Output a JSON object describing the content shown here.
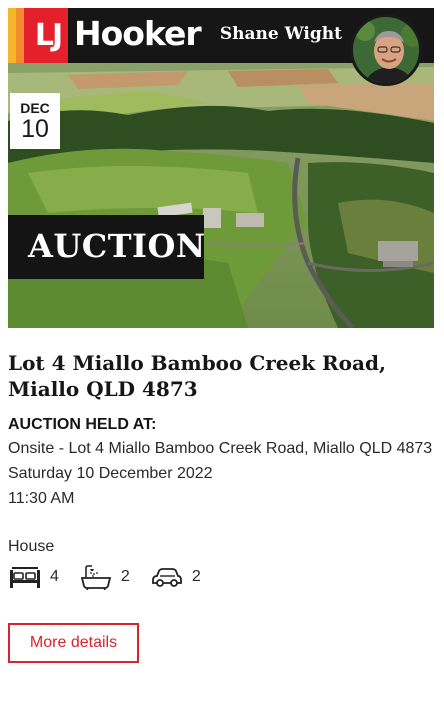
{
  "header": {
    "brand_lj": "LJ",
    "brand_name": "Hooker",
    "agent_name": "Shane Wight",
    "stripe_colors": [
      "#f6b62b",
      "#f18b2d",
      "#e4202d"
    ]
  },
  "listing": {
    "date_month": "DEC",
    "date_day": "10",
    "sale_type": "AUCTION",
    "title": "Lot 4 Miallo Bamboo Creek Road, Miallo QLD 4873",
    "held_label": "AUCTION HELD AT:",
    "location": "Onsite - Lot 4 Miallo Bamboo Creek Road, Miallo QLD 4873",
    "date_text": "Saturday 10 December 2022",
    "time_text": "11:30 AM",
    "property_type": "House",
    "features": [
      {
        "icon": "bed-icon",
        "count": "4"
      },
      {
        "icon": "bath-icon",
        "count": "2"
      },
      {
        "icon": "car-icon",
        "count": "2"
      }
    ],
    "more_details_label": "More details"
  },
  "colors": {
    "accent": "#d9232d",
    "header_bg": "#161616"
  }
}
